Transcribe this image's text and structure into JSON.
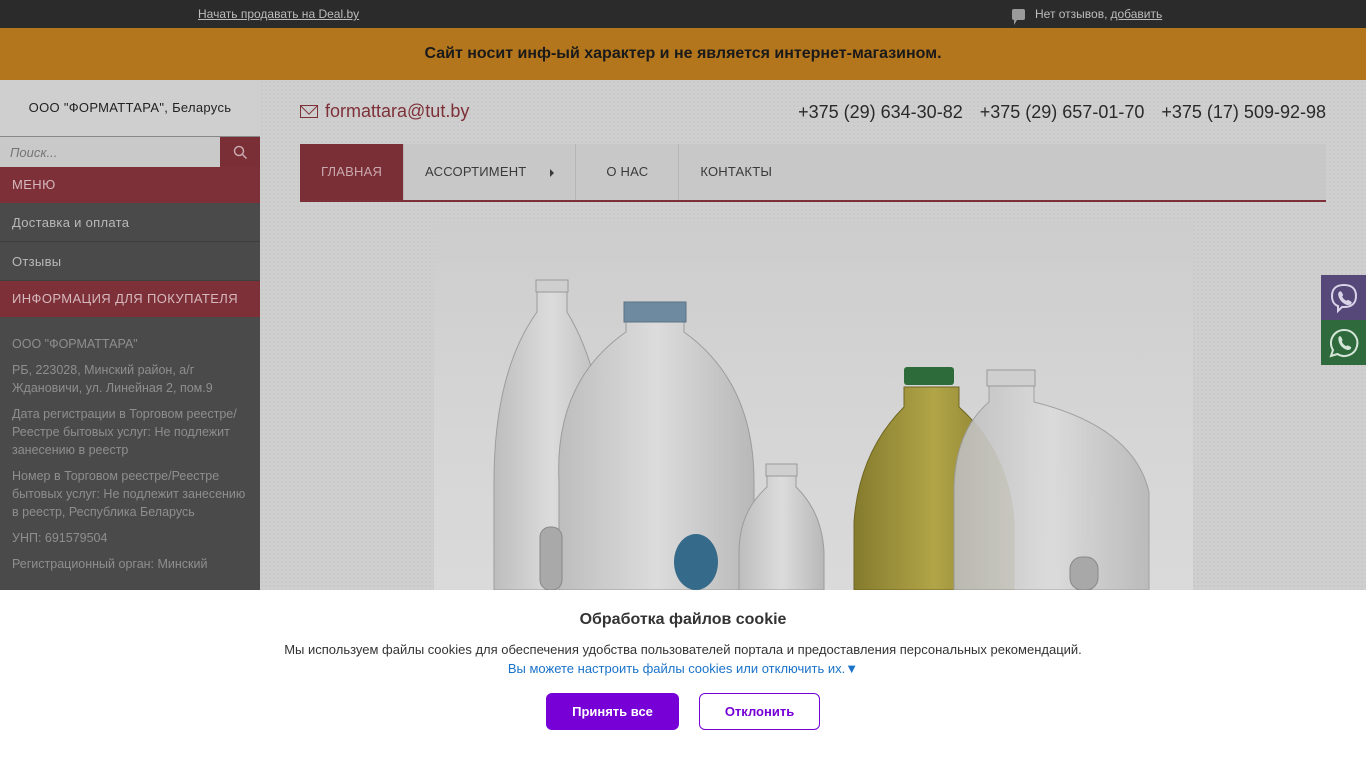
{
  "topbar": {
    "sell_link": "Начать продавать на Deal.by",
    "reviews_text": "Нет отзывов,",
    "reviews_add": "добавить"
  },
  "notice": "Сайт носит инф-ый характер и не является интернет-магазином.",
  "sidebar": {
    "company": "ООО \"ФОРМАТТАРА\", Беларусь",
    "search_placeholder": "Поиск...",
    "menu_header": "МЕНЮ",
    "menu_items": [
      "Доставка и оплата",
      "Отзывы"
    ],
    "info_header": "ИНФОРМАЦИЯ ДЛЯ ПОКУПАТЕЛЯ",
    "info_lines": [
      "ООО \"ФОРМАТТАРА\"",
      "РБ, 223028, Минский район, а/г Ждановичи, ул. Линейная 2, пом.9",
      "Дата регистрации в Торговом реестре/Реестре бытовых услуг: Не подлежит занесению в реестр",
      "Номер в Торговом реестре/Реестре бытовых услуг: Не подлежит занесению в реестр, Республика Беларусь",
      "УНП: 691579504",
      "Регистрационный орган: Минский"
    ]
  },
  "header": {
    "email": "formattara@tut.by",
    "phones": [
      "+375 (29) 634-30-82",
      "+375 (29) 657-01-70",
      "+375 (17) 509-92-98"
    ]
  },
  "nav": {
    "items": [
      "ГЛАВНАЯ",
      "АССОРТИМЕНТ",
      "О НАС",
      "КОНТАКТЫ"
    ]
  },
  "cookie": {
    "title": "Обработка файлов cookie",
    "text": "Мы используем файлы cookies для обеспечения удобства пользователей портала и предоставления персональных рекомендаций.",
    "configure": "Вы можете настроить файлы cookies или отключить их.▼",
    "accept": "Принять все",
    "decline": "Отклонить"
  },
  "icons": {
    "search": "search-icon",
    "mail": "mail-icon",
    "viber": "viber-icon",
    "whatsapp": "whatsapp-icon"
  },
  "colors": {
    "accent": "#7d3038",
    "notice_bg": "#b4761c",
    "button": "#7600d6",
    "viber": "#56497a",
    "whatsapp": "#2e6a3b"
  }
}
